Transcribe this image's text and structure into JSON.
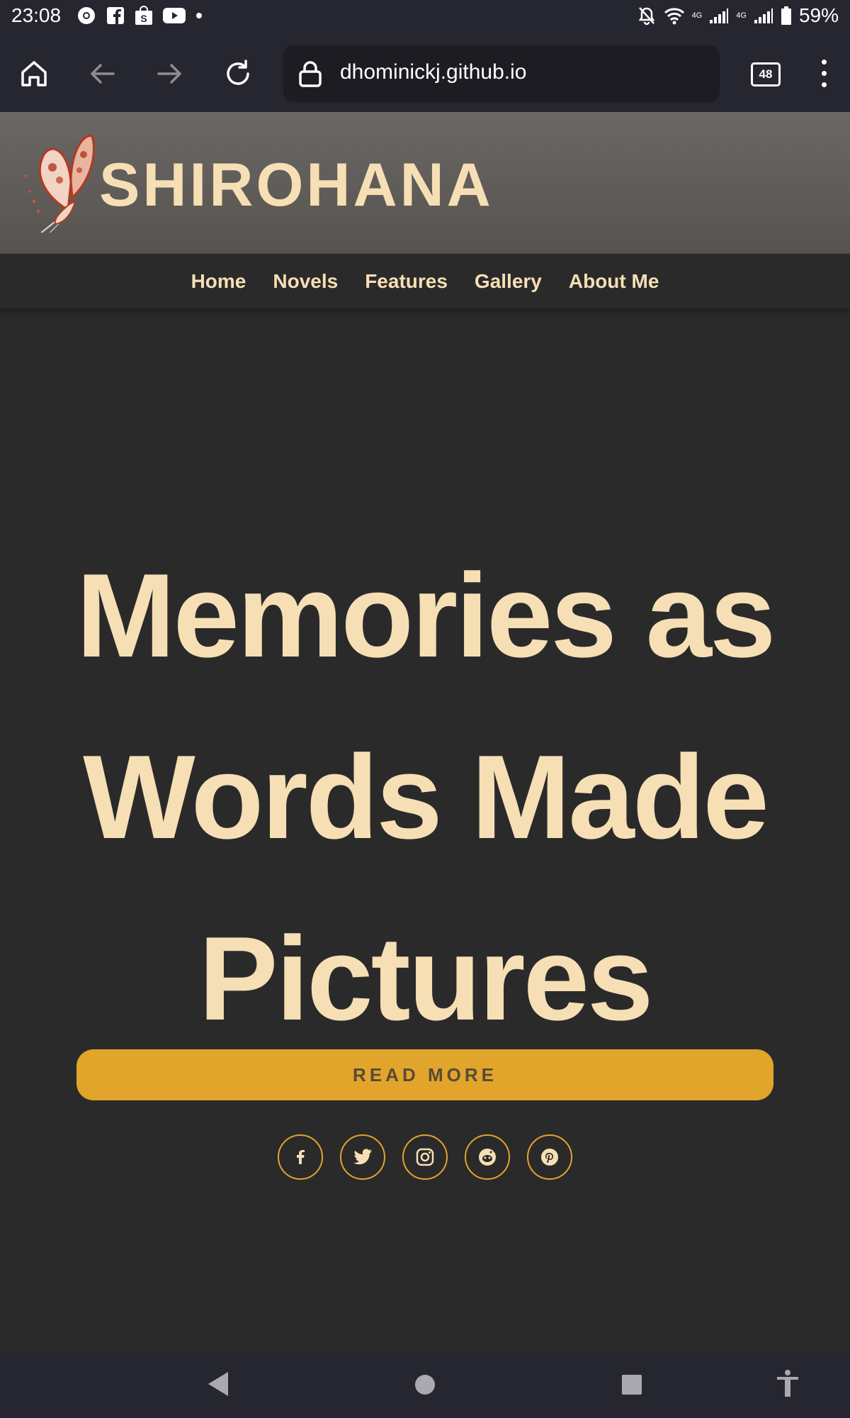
{
  "status_bar": {
    "time": "23:08",
    "left_icons": [
      "chrome-icon",
      "facebook-icon",
      "shopping-bag-icon",
      "youtube-icon",
      "dot-icon"
    ],
    "signal_label_1": "4G",
    "signal_label_2": "4G",
    "battery": "59%"
  },
  "browser": {
    "url": "dhominickj.github.io",
    "tab_count": "48"
  },
  "site": {
    "brand": "SHIROHANA",
    "nav": [
      "Home",
      "Novels",
      "Features",
      "Gallery",
      "About Me"
    ],
    "hero_line1": "Memories as",
    "hero_line2": "Words Made",
    "hero_line3": "Pictures",
    "read_more": "READ MORE",
    "social": [
      "facebook-icon",
      "twitter-icon",
      "instagram-icon",
      "reddit-icon",
      "pinterest-icon"
    ]
  },
  "colors": {
    "accent": "#e1a52b",
    "cream": "#f6dfb4",
    "background": "#2b2a2b"
  }
}
